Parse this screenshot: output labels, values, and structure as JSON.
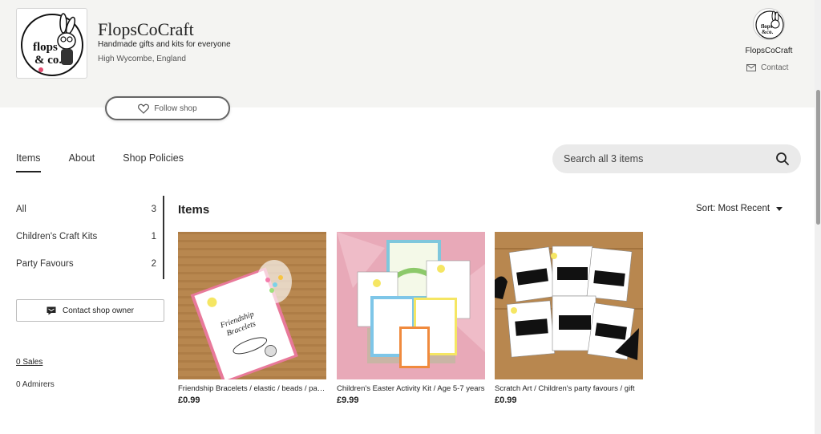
{
  "shop": {
    "name": "FlopsCoCraft",
    "tagline": "Handmade gifts and kits for everyone",
    "location": "High Wycombe, England",
    "logo_text": "flops & co."
  },
  "owner": {
    "name": "FlopsCoCraft",
    "contact_label": "Contact"
  },
  "follow_label": "Follow shop",
  "tabs": [
    {
      "label": "Items",
      "active": true
    },
    {
      "label": "About",
      "active": false
    },
    {
      "label": "Shop Policies",
      "active": false
    }
  ],
  "search": {
    "placeholder": "Search all 3 items"
  },
  "sidebar": {
    "sections": [
      {
        "label": "All",
        "count": "3"
      },
      {
        "label": "Children's Craft Kits",
        "count": "1"
      },
      {
        "label": "Party Favours",
        "count": "2"
      }
    ],
    "contact_owner_label": "Contact shop owner",
    "sales_label": "0 Sales",
    "admirers_label": "0 Admirers"
  },
  "main": {
    "heading": "Items",
    "sort_label": "Sort: Most Recent"
  },
  "listings": [
    {
      "title": "Friendship Bracelets / elastic / beads / party favours",
      "price": "£0.99"
    },
    {
      "title": "Children's Easter Activity Kit / Age 5-7 years",
      "price": "£9.99"
    },
    {
      "title": "Scratch Art / Children's party favours / gift",
      "price": "£0.99"
    }
  ],
  "colors": {
    "banner_bg": "#f4f4f2",
    "search_bg": "#eaeaea",
    "wood": "#b8874f",
    "pink_paper": "#e8a9b8"
  },
  "icons": {
    "heart": "heart-icon",
    "mail": "mail-icon",
    "search": "search-icon",
    "chat": "chat-icon",
    "sort": "caret-down-icon"
  }
}
